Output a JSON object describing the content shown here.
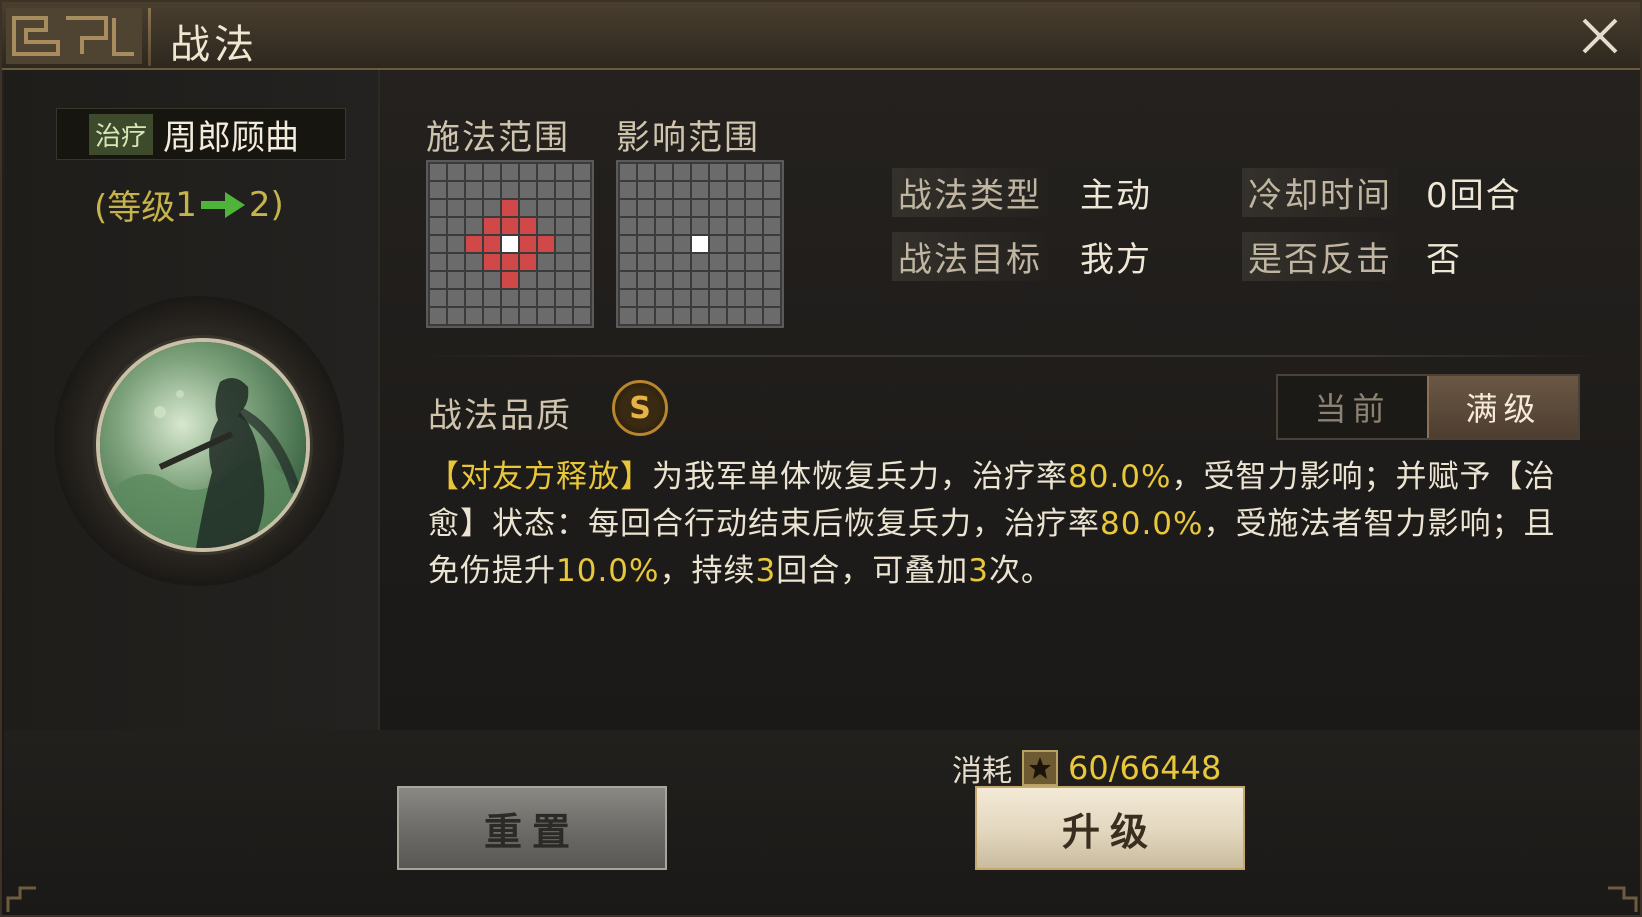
{
  "window": {
    "title": "战法"
  },
  "skill": {
    "tag": "治疗",
    "name": "周郎顾曲",
    "level_prefix": "(等级",
    "level_from": "1",
    "level_to": "2",
    "level_suffix": ")"
  },
  "ranges": {
    "cast_label": "施法范围",
    "effect_label": "影响范围"
  },
  "info": {
    "type_label": "战法类型",
    "type_value": "主动",
    "cooldown_label": "冷却时间",
    "cooldown_value": "0回合",
    "target_label": "战法目标",
    "target_value": "我方",
    "counter_label": "是否反击",
    "counter_value": "否"
  },
  "quality": {
    "label": "战法品质",
    "grade": "S"
  },
  "toggle": {
    "current": "当前",
    "max": "满级"
  },
  "description": {
    "p1": "【对友方释放】",
    "p2": "为我军单体恢复兵力，治疗率",
    "p3": "80.0%",
    "p4": "，受智力影响；并赋予",
    "p5": "【治愈】状态：每回合行动结束后恢复兵力，治疗率",
    "p6": "80.0%",
    "p7": "，受施法者智力影响；且免伤提升",
    "p8": "10.0%",
    "p9": "，持续",
    "p10": "3",
    "p11": "回合，可叠加",
    "p12": "3",
    "p13": "次。"
  },
  "cost": {
    "label": "消耗",
    "value": "60/66448",
    "icon": "command-token-icon"
  },
  "buttons": {
    "reset": "重置",
    "upgrade": "升级"
  },
  "colors": {
    "accent_gold": "#e8c73a",
    "cast_cell": "#d04848",
    "center_cell": "#ffffff",
    "grid_cell": "#6b6b6b"
  }
}
